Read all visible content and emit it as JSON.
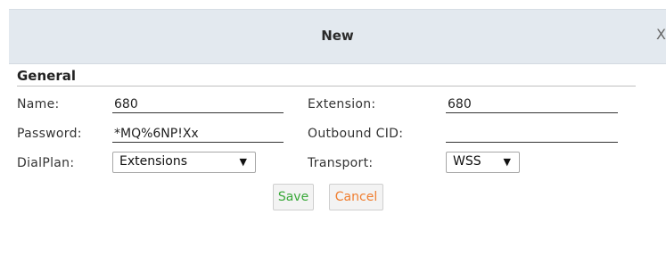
{
  "dialog": {
    "title": "New",
    "close_label": "X"
  },
  "section": {
    "title": "General"
  },
  "form": {
    "name": {
      "label": "Name:",
      "value": "680"
    },
    "password": {
      "label": "Password:",
      "value": "*MQ%6NP!Xx"
    },
    "dialplan": {
      "label": "DialPlan:",
      "value": "Extensions"
    },
    "extension": {
      "label": "Extension:",
      "value": "680"
    },
    "outbound_cid": {
      "label": "Outbound CID:",
      "value": ""
    },
    "transport": {
      "label": "Transport:",
      "value": "WSS"
    }
  },
  "buttons": {
    "save": "Save",
    "cancel": "Cancel"
  },
  "colors": {
    "titlebar_bg": "#e3e9ef",
    "save_text": "#39a839",
    "cancel_text": "#f07d2e"
  }
}
